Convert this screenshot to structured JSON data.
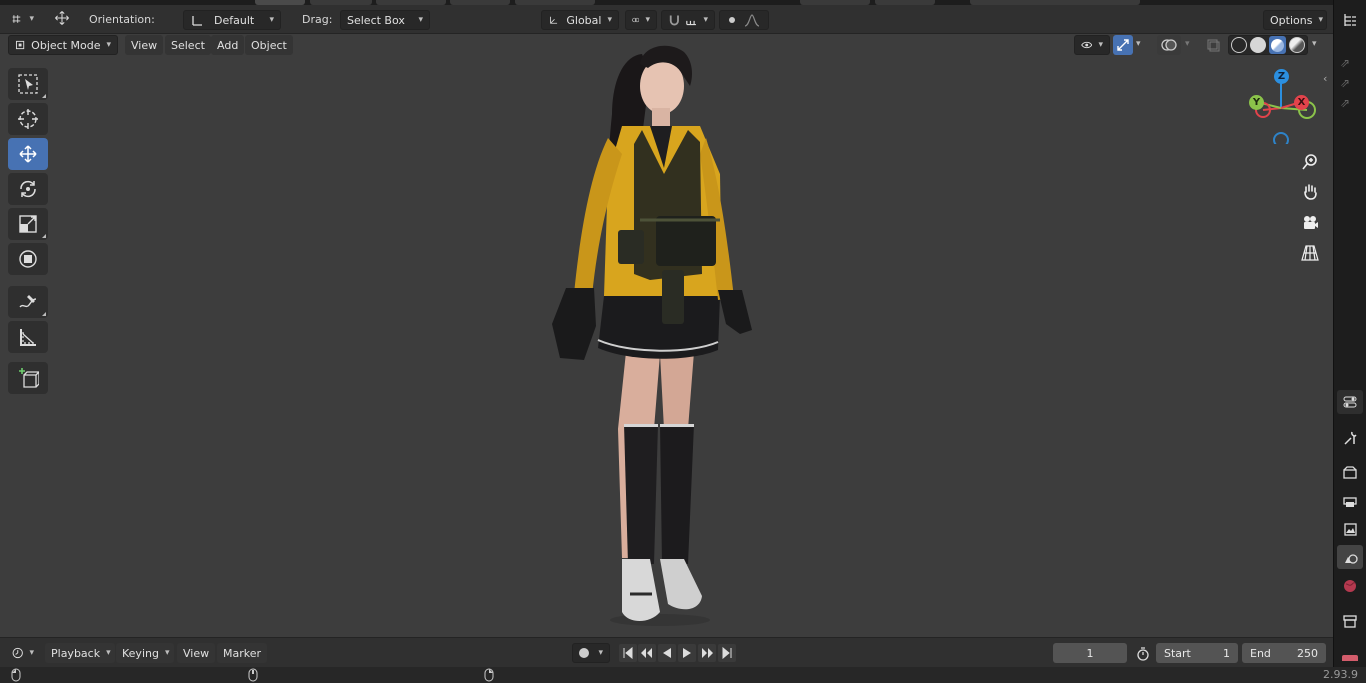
{
  "header": {
    "orientation_label": "Orientation:",
    "orientation_value": "Default",
    "drag_label": "Drag:",
    "drag_value": "Select Box",
    "transform_space": "Global",
    "options_label": "Options"
  },
  "viewport_header": {
    "mode": "Object Mode",
    "menus": [
      "View",
      "Select",
      "Add",
      "Object"
    ]
  },
  "toolbar": {
    "tools": [
      "select-box",
      "cursor",
      "move",
      "rotate",
      "scale",
      "transform",
      "annotate",
      "measure",
      "add-cube"
    ],
    "active_tool": "move"
  },
  "gizmo": {
    "z": "Z",
    "y": "Y",
    "x": "X"
  },
  "timeline": {
    "menus": [
      "Playback",
      "Keying",
      "View",
      "Marker"
    ],
    "current_frame": "1",
    "start_label": "Start",
    "start_value": "1",
    "end_label": "End",
    "end_value": "250"
  },
  "status": {
    "version": "2.93.9"
  },
  "colors": {
    "accent": "#4772b3",
    "viewport_bg": "#3d3d3d",
    "header_bg": "#303030",
    "axis_x": "#e2434b",
    "axis_y": "#8bc34a",
    "axis_z": "#2b8fe0",
    "jacket": "#d8a51e"
  }
}
